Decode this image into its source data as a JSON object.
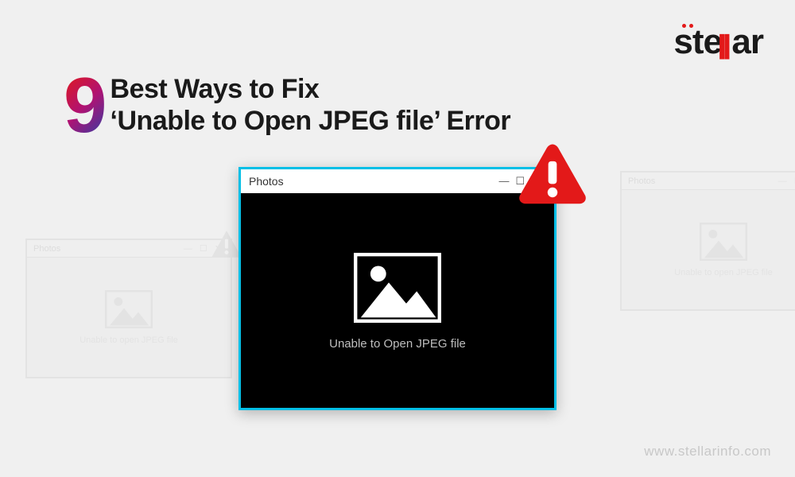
{
  "brand": {
    "name_pre": "ste",
    "name_mid": "ll",
    "name_post": "ar",
    "url": "www.stellarinfo.com"
  },
  "headline": {
    "number": "9",
    "line1": "Best Ways to Fix",
    "line2": "‘Unable to Open JPEG file’ Error"
  },
  "window": {
    "app_name": "Photos",
    "error_text": "Unable to Open JPEG file"
  },
  "faded_window": {
    "app_name": "Photos",
    "error_text": "Unable to open JPEG file"
  },
  "icons": {
    "alert": "alert-triangle-icon",
    "image_placeholder": "image-mountain-icon"
  },
  "colors": {
    "accent_red": "#e31919",
    "accent_blue": "#00bfe6",
    "gradient_start": "#e31919",
    "gradient_end": "#2c3ea8"
  }
}
